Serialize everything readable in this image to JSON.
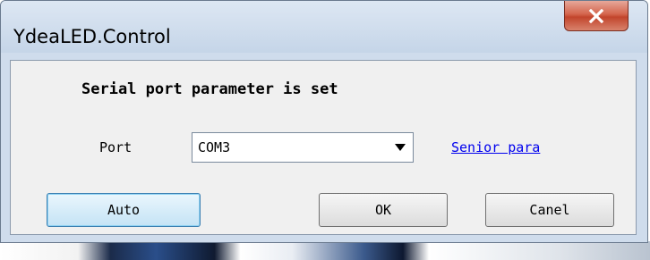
{
  "window": {
    "title": "YdeaLED.Control"
  },
  "dialog": {
    "heading": "Serial port parameter is set",
    "port_label": "Port",
    "port_value": "COM3",
    "senior_link": "Senior para",
    "buttons": {
      "auto": "Auto",
      "ok": "OK",
      "cancel": "Canel"
    }
  },
  "icons": {
    "close": "close-icon",
    "dropdown": "chevron-down-icon"
  },
  "colors": {
    "close_button": "#c2452c",
    "link": "#0000ee",
    "focus_border": "#3c7fb1"
  }
}
